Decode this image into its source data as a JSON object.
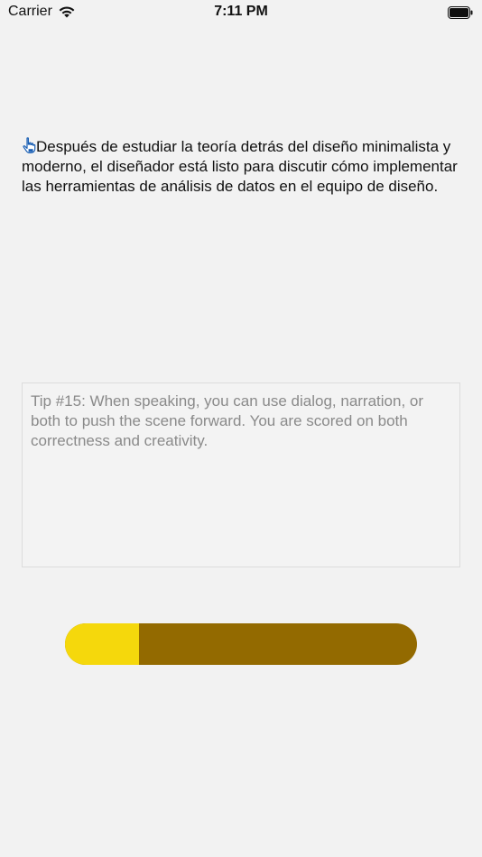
{
  "status_bar": {
    "carrier": "Carrier",
    "time": "7:11 PM"
  },
  "narration": {
    "icon": "hand-pointer-icon",
    "text": "Después de estudiar la teoría detrás del diseño minimalista y moderno, el diseñador está listo para discutir cómo implementar las herramientas de análisis de  datos en el equipo de diseño."
  },
  "tip": {
    "placeholder": "Tip #15: When speaking, you can use dialog, narration, or both to push the scene forward. You are scored on both correctness and creativity."
  },
  "progress": {
    "value": 0.21,
    "fill_color": "#f5d80c",
    "track_color": "#936a00"
  }
}
